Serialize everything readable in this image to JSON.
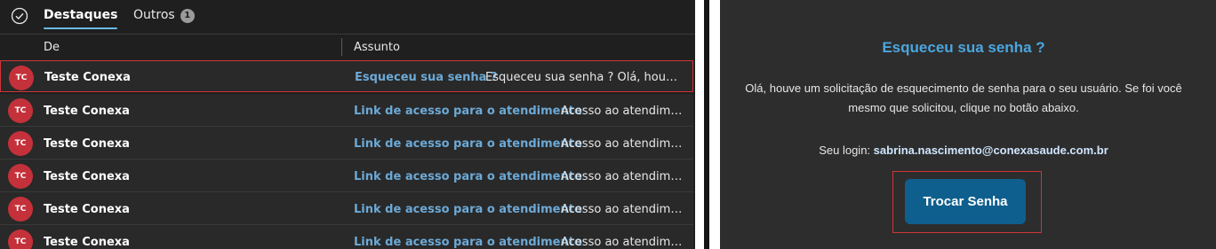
{
  "tabs": {
    "highlights": "Destaques",
    "others": "Outros",
    "others_badge": "1"
  },
  "columns": {
    "from": "De",
    "subject": "Assunto"
  },
  "messages": [
    {
      "initials": "TC",
      "sender": "Teste Conexa",
      "subject": "Esqueceu sua senha ?",
      "preview": "Esqueceu sua senha ? Olá, houve um solicitação de esquecimento de senha",
      "selected": true
    },
    {
      "initials": "TC",
      "sender": "Teste Conexa",
      "subject": "Link de acesso para o atendimento",
      "preview": "Acesso ao atendimento"
    },
    {
      "initials": "TC",
      "sender": "Teste Conexa",
      "subject": "Link de acesso para o atendimento",
      "preview": "Acesso ao atendimento"
    },
    {
      "initials": "TC",
      "sender": "Teste Conexa",
      "subject": "Link de acesso para o atendimento",
      "preview": "Acesso ao atendimento"
    },
    {
      "initials": "TC",
      "sender": "Teste Conexa",
      "subject": "Link de acesso para o atendimento",
      "preview": "Acesso ao atendimento"
    },
    {
      "initials": "TC",
      "sender": "Teste Conexa",
      "subject": "Link de acesso para o atendimento",
      "preview": "Acesso ao atendimento"
    }
  ],
  "email": {
    "title": "Esqueceu sua senha ?",
    "body": "Olá, houve um solicitação de esquecimento de senha para o seu usuário. Se foi você mesmo que solicitou, clique no botão abaixo.",
    "login_label": "Seu login:",
    "login_value": "sabrina.nascimento@conexasaude.com.br",
    "button_label": "Trocar Senha"
  },
  "colors": {
    "accent": "#4aa6e0",
    "selection_border": "#d13438",
    "avatar": "#c4313a",
    "button": "#0f5f8e"
  }
}
